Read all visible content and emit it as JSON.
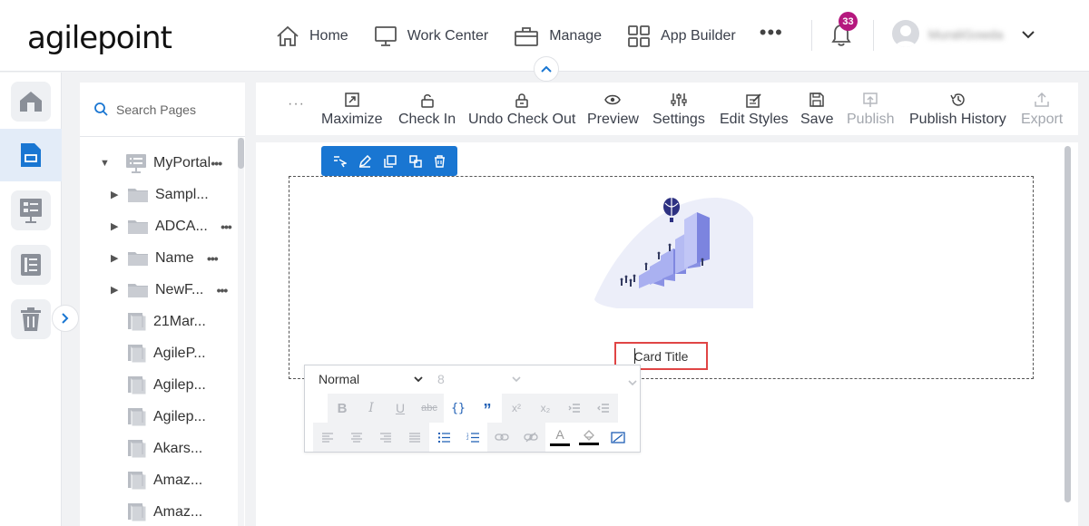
{
  "app": {
    "logo_text": "agilepoint"
  },
  "nav": {
    "items": [
      {
        "label": "Home",
        "icon": "home-icon"
      },
      {
        "label": "Work Center",
        "icon": "monitor-icon"
      },
      {
        "label": "Manage",
        "icon": "briefcase-icon"
      },
      {
        "label": "App Builder",
        "icon": "grid-icon"
      }
    ],
    "more": "•••",
    "notification_count": "33",
    "user_name": "MuraliGowda"
  },
  "rail": {
    "items": [
      "home-icon",
      "page-icon",
      "process-icon",
      "list-icon",
      "trash-icon"
    ],
    "active_index": 1
  },
  "tree": {
    "search_placeholder": "Search Pages",
    "root": "MyPortal",
    "items": [
      {
        "label": "Sampl...",
        "type": "folder",
        "dots": false
      },
      {
        "label": "ADCA...",
        "type": "folder",
        "dots": true
      },
      {
        "label": "Name",
        "type": "folder",
        "dots": true
      },
      {
        "label": "NewF...",
        "type": "folder",
        "dots": true
      },
      {
        "label": "21Mar...",
        "type": "page",
        "dots": false
      },
      {
        "label": "AgileP...",
        "type": "page",
        "dots": false
      },
      {
        "label": "Agilep...",
        "type": "page",
        "dots": false
      },
      {
        "label": "Agilep...",
        "type": "page",
        "dots": false
      },
      {
        "label": "Akars...",
        "type": "page",
        "dots": false
      },
      {
        "label": "Amaz...",
        "type": "page",
        "dots": false
      },
      {
        "label": "Amaz...",
        "type": "page",
        "dots": false
      }
    ]
  },
  "toolbar": {
    "more": "···",
    "items": [
      {
        "label": "Maximize",
        "icon": "maximize-icon",
        "enabled": true
      },
      {
        "label": "Check In",
        "icon": "unlock-icon",
        "enabled": true
      },
      {
        "label": "Undo Check Out",
        "icon": "undo-lock-icon",
        "enabled": true
      },
      {
        "label": "Preview",
        "icon": "eye-icon",
        "enabled": true
      },
      {
        "label": "Settings",
        "icon": "sliders-icon",
        "enabled": true
      },
      {
        "label": "Edit Styles",
        "icon": "edit-styles-icon",
        "enabled": true
      },
      {
        "label": "Save",
        "icon": "save-icon",
        "enabled": true
      },
      {
        "label": "Publish",
        "icon": "publish-icon",
        "enabled": false
      },
      {
        "label": "Publish History",
        "icon": "history-icon",
        "enabled": true
      },
      {
        "label": "Export",
        "icon": "export-icon",
        "enabled": false
      }
    ]
  },
  "canvas": {
    "card_title": "Card Title"
  },
  "editor": {
    "format_value": "Normal",
    "size_value": "8"
  },
  "colors": {
    "accent": "#1976d2",
    "badge": "#b5187e",
    "highlight": "#e04545"
  }
}
